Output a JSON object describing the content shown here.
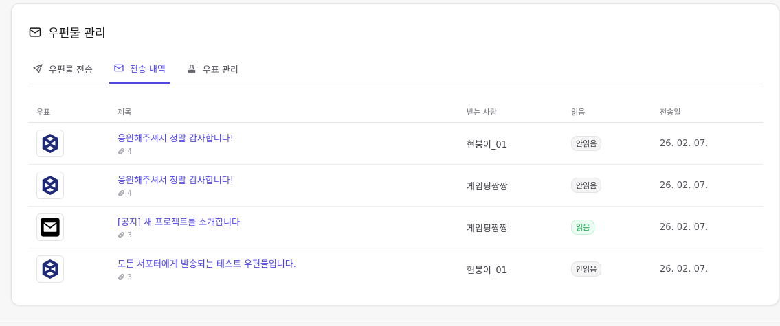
{
  "header": {
    "title": "우편물 관리",
    "icon": "mail-icon"
  },
  "tabs": [
    {
      "label": "우편물 전송",
      "icon": "send-icon",
      "active": false
    },
    {
      "label": "전송 내역",
      "icon": "mail-icon",
      "active": true
    },
    {
      "label": "우표 관리",
      "icon": "stamp-icon",
      "active": false
    }
  ],
  "table": {
    "columns": [
      "우표",
      "제목",
      "받는 사람",
      "읽음",
      "전송일"
    ],
    "rows": [
      {
        "stamp": "knot-logo-stamp",
        "subject": "응원해주셔서 정말 감사합니다!",
        "attachments": "4",
        "recipient": "현붕이_01",
        "status": "안읽음",
        "date": "26. 02. 07."
      },
      {
        "stamp": "knot-logo-stamp",
        "subject": "응원해주셔서 정말 감사합니다!",
        "attachments": "4",
        "recipient": "게임핑짱짱",
        "status": "안읽음",
        "date": "26. 02. 07."
      },
      {
        "stamp": "envelope-stamp",
        "subject": "[공지] 새 프로젝트를 소개합니다",
        "attachments": "3",
        "recipient": "게임핑짱짱",
        "status": "읽음",
        "date": "26. 02. 07."
      },
      {
        "stamp": "knot-logo-stamp",
        "subject": "모든 서포터에게 발송되는 테스트 우편물입니다.",
        "attachments": "3",
        "recipient": "현붕이_01",
        "status": "안읽음",
        "date": "26. 02. 07."
      }
    ]
  },
  "colors": {
    "accent": "#4f46e5",
    "read_badge": "#16a34a",
    "stamp_logo": "#1e2a78"
  }
}
